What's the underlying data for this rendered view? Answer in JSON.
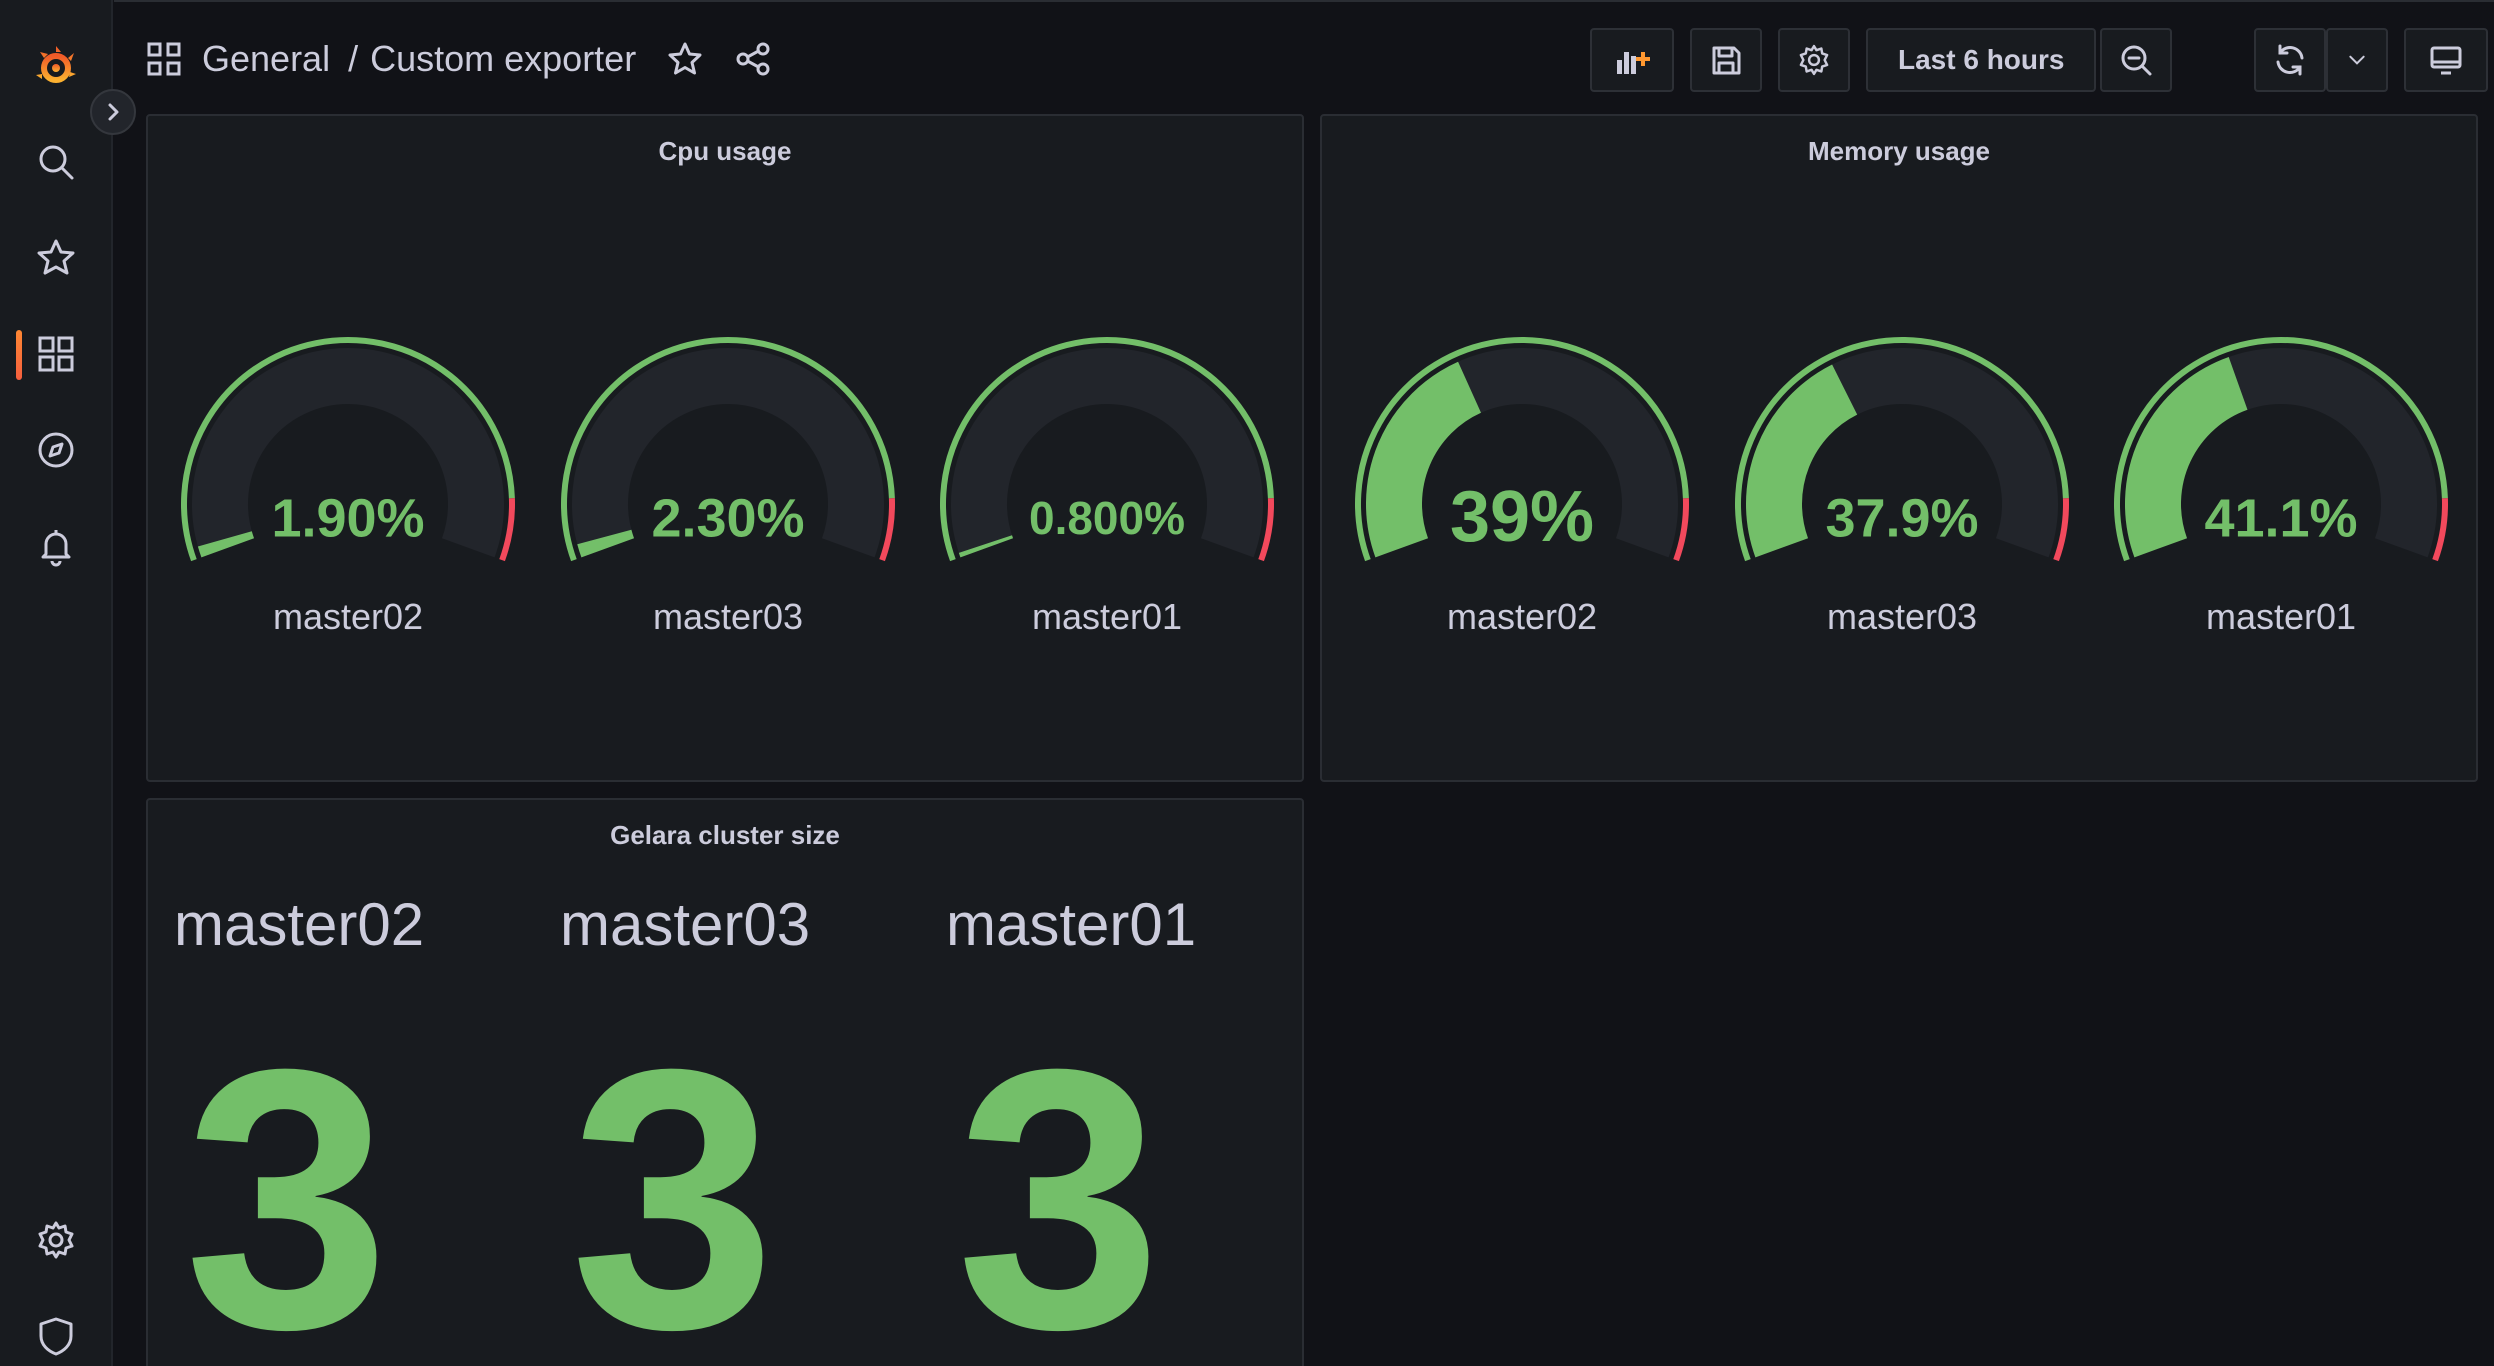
{
  "sidebar": {
    "items": [
      {
        "name": "grafana-logo"
      },
      {
        "name": "search-icon"
      },
      {
        "name": "starred-icon"
      },
      {
        "name": "dashboards-icon",
        "active": true
      },
      {
        "name": "explore-icon"
      },
      {
        "name": "alerting-icon"
      }
    ],
    "bottom_items": [
      {
        "name": "configuration-gear-icon"
      },
      {
        "name": "server-admin-shield-icon"
      }
    ],
    "accent_color": "#f55f3e"
  },
  "breadcrumb": {
    "folder": "General",
    "separator": "/",
    "dashboard": "Custom exporter"
  },
  "toolbar": {
    "time_range": "Last 6 hours",
    "buttons": [
      "add-panel",
      "save-dashboard",
      "dashboard-settings",
      "time-picker",
      "zoom-out",
      "refresh",
      "refresh-interval",
      "tv-mode"
    ]
  },
  "panels": {
    "cpu": {
      "title": "Cpu usage",
      "gauges": [
        {
          "label": "master02",
          "value": "1.90%",
          "fraction": 0.019
        },
        {
          "label": "master03",
          "value": "2.30%",
          "fraction": 0.023
        },
        {
          "label": "master01",
          "value": "0.800%",
          "fraction": 0.008
        }
      ]
    },
    "memory": {
      "title": "Memory usage",
      "gauges": [
        {
          "label": "master02",
          "value": "39%",
          "fraction": 0.39
        },
        {
          "label": "master03",
          "value": "37.9%",
          "fraction": 0.379
        },
        {
          "label": "master01",
          "value": "41.1%",
          "fraction": 0.411
        }
      ]
    },
    "cluster": {
      "title": "Gelara cluster size",
      "stats": [
        {
          "label": "master02",
          "value": "3"
        },
        {
          "label": "master03",
          "value": "3"
        },
        {
          "label": "master01",
          "value": "3"
        }
      ]
    }
  },
  "colors": {
    "green": "#73bf69",
    "red": "#f2495c",
    "panel_bg": "#181b1f",
    "page_bg": "#111217"
  }
}
